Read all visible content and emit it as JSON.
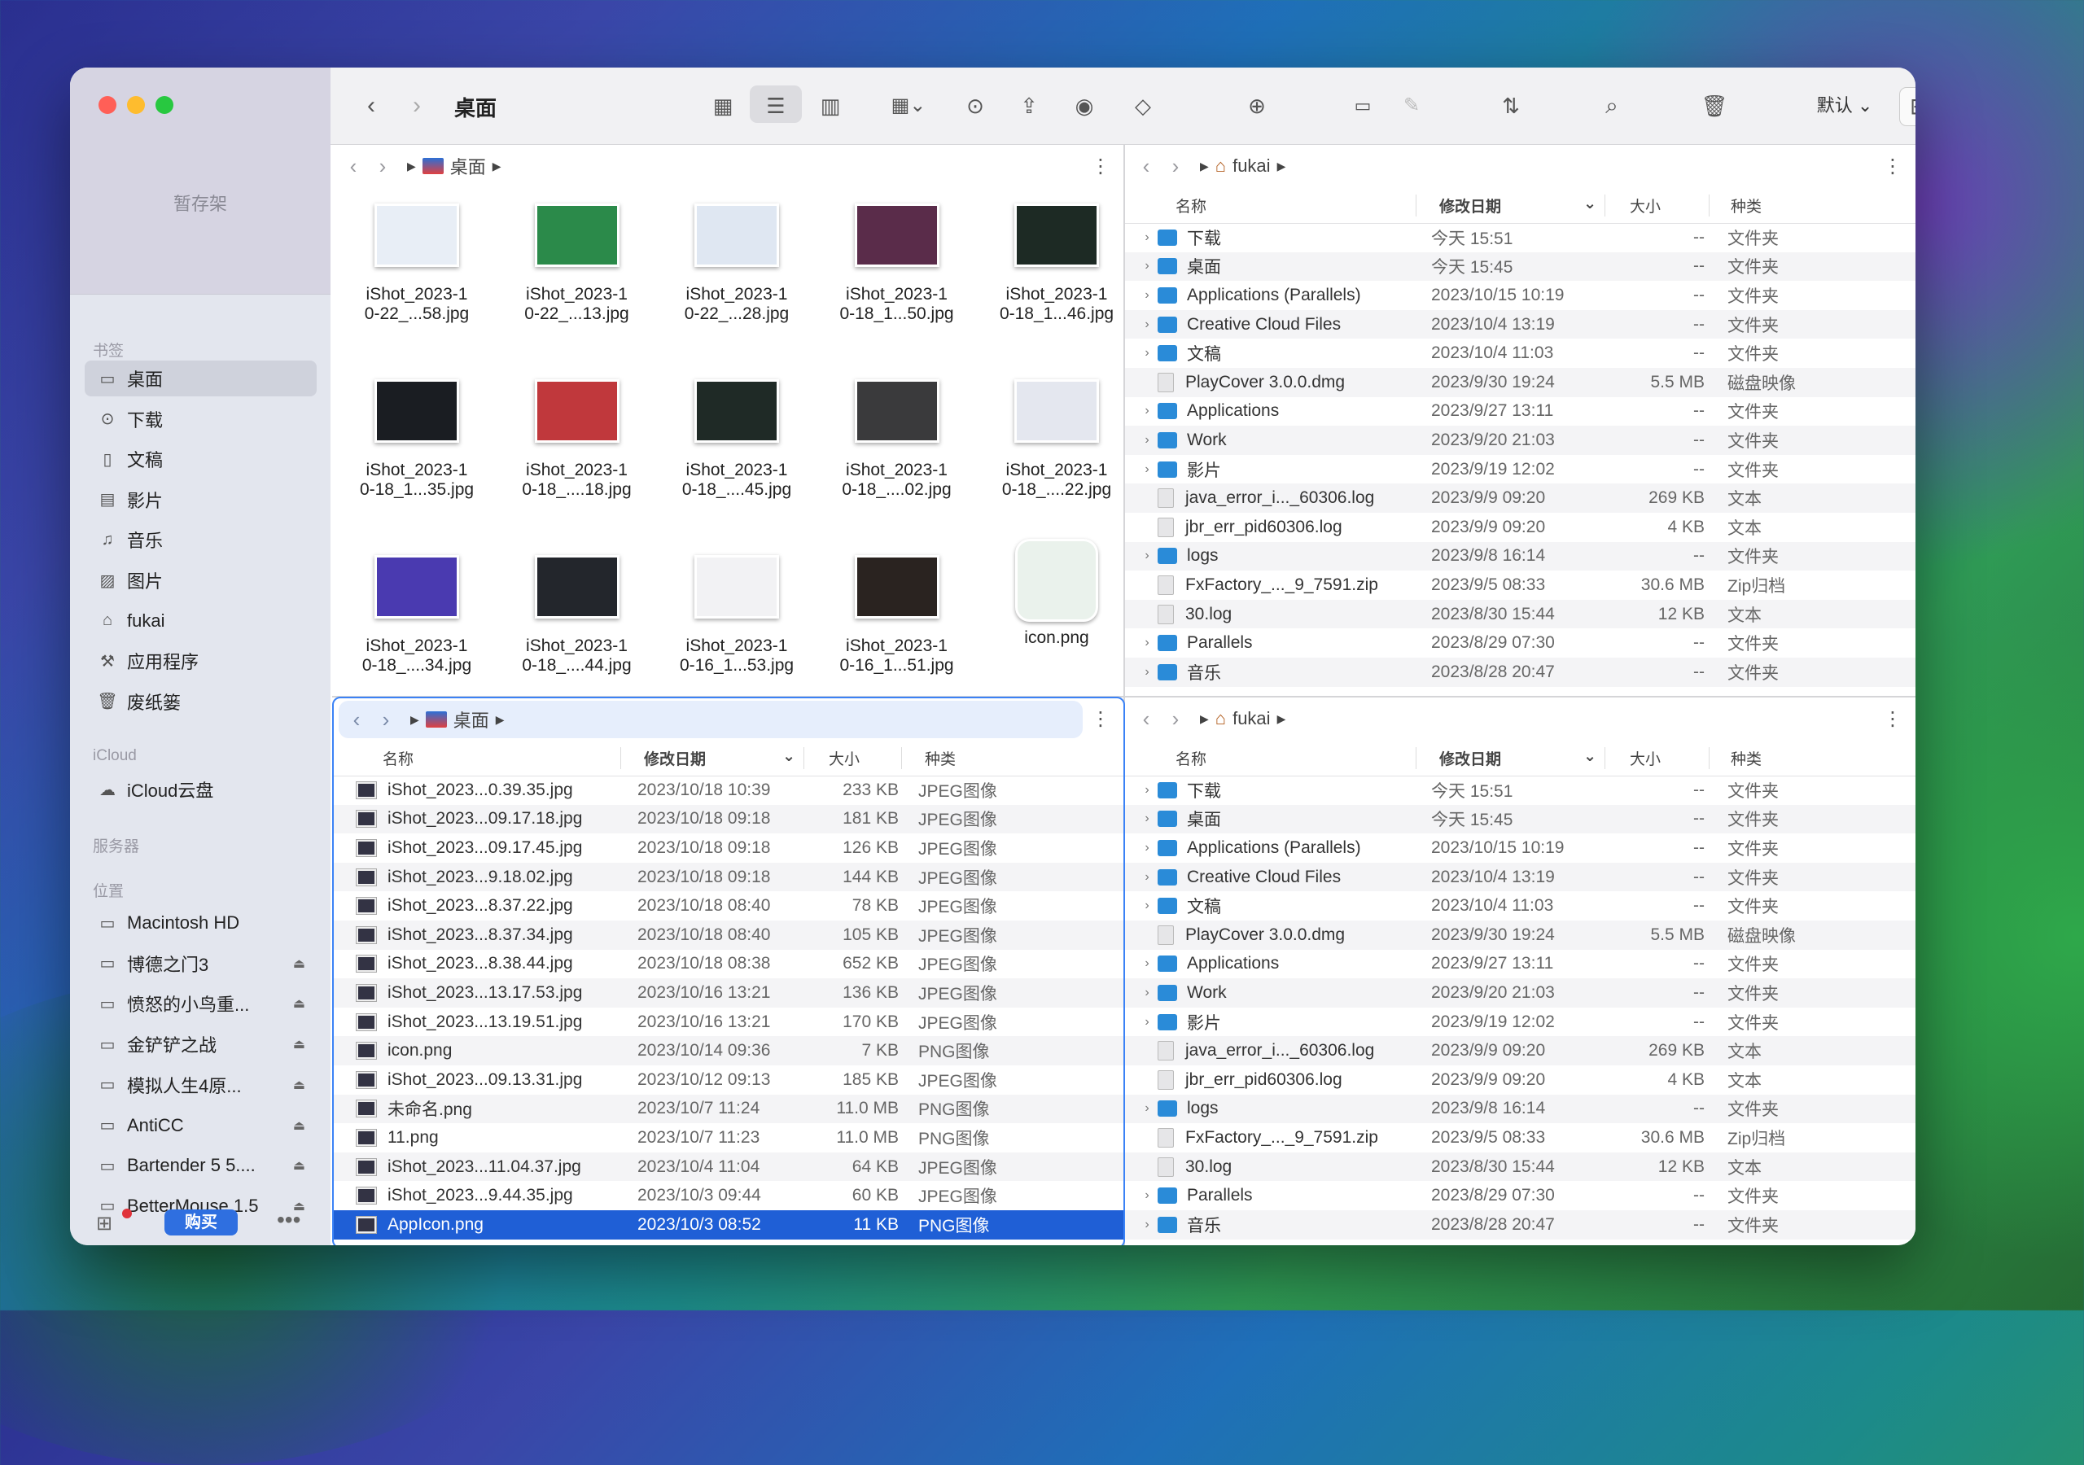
{
  "toolbar": {
    "title": "桌面",
    "default_label": "默认"
  },
  "sidebar": {
    "shelf_label": "暂存架",
    "sections": {
      "bookmarks": "书签",
      "icloud": "iCloud",
      "servers": "服务器",
      "locations": "位置"
    },
    "bookmarks": [
      {
        "label": "桌面",
        "icon": "desktop-icon"
      },
      {
        "label": "下载",
        "icon": "download-icon"
      },
      {
        "label": "文稿",
        "icon": "document-icon"
      },
      {
        "label": "影片",
        "icon": "film-icon"
      },
      {
        "label": "音乐",
        "icon": "music-icon"
      },
      {
        "label": "图片",
        "icon": "photo-icon"
      },
      {
        "label": "fukai",
        "icon": "home-icon"
      },
      {
        "label": "应用程序",
        "icon": "apps-icon"
      },
      {
        "label": "废纸篓",
        "icon": "trash-icon"
      }
    ],
    "icloud": [
      {
        "label": "iCloud云盘",
        "icon": "cloud-icon"
      }
    ],
    "locations": [
      {
        "label": "Macintosh HD"
      },
      {
        "label": "博德之门3"
      },
      {
        "label": "愤怒的小鸟重..."
      },
      {
        "label": "金铲铲之战"
      },
      {
        "label": "模拟人生4原..."
      },
      {
        "label": "AntiCC"
      },
      {
        "label": "Bartender 5 5...."
      },
      {
        "label": "BetterMouse 1.5"
      }
    ],
    "buy_label": "购买"
  },
  "pane_tl": {
    "path": "桌面",
    "items": [
      {
        "l1": "iShot_2023-1",
        "l2": "0-22_...58.jpg",
        "c": "#e8eef6"
      },
      {
        "l1": "iShot_2023-1",
        "l2": "0-22_...13.jpg",
        "c": "#2b8a4a"
      },
      {
        "l1": "iShot_2023-1",
        "l2": "0-22_...28.jpg",
        "c": "#dfe7f2"
      },
      {
        "l1": "iShot_2023-1",
        "l2": "0-18_1...50.jpg",
        "c": "#5a2c4a"
      },
      {
        "l1": "iShot_2023-1",
        "l2": "0-18_1...46.jpg",
        "c": "#1d2a24"
      },
      {
        "l1": "iShot_2023-1",
        "l2": "0-18_1...35.jpg",
        "c": "#1a1d22"
      },
      {
        "l1": "iShot_2023-1",
        "l2": "0-18_....18.jpg",
        "c": "#c0383c"
      },
      {
        "l1": "iShot_2023-1",
        "l2": "0-18_....45.jpg",
        "c": "#1f2a26"
      },
      {
        "l1": "iShot_2023-1",
        "l2": "0-18_....02.jpg",
        "c": "#3a3a3c"
      },
      {
        "l1": "iShot_2023-1",
        "l2": "0-18_....22.jpg",
        "c": "#e4e7ef"
      },
      {
        "l1": "iShot_2023-1",
        "l2": "0-18_....34.jpg",
        "c": "#4a3ab0"
      },
      {
        "l1": "iShot_2023-1",
        "l2": "0-18_....44.jpg",
        "c": "#23262c"
      },
      {
        "l1": "iShot_2023-1",
        "l2": "0-16_1...53.jpg",
        "c": "#f2f2f4"
      },
      {
        "l1": "iShot_2023-1",
        "l2": "0-16_1...51.jpg",
        "c": "#2a2320"
      },
      {
        "l1": "icon.png",
        "l2": "",
        "c": "#eaf2ec"
      }
    ]
  },
  "pane_bl": {
    "path": "桌面",
    "cols": {
      "name": "名称",
      "date": "修改日期",
      "size": "大小",
      "kind": "种类"
    },
    "rows": [
      {
        "name": "iShot_2023...0.39.35.jpg",
        "date": "2023/10/18 10:39",
        "size": "233 KB",
        "kind": "JPEG图像"
      },
      {
        "name": "iShot_2023...09.17.18.jpg",
        "date": "2023/10/18 09:18",
        "size": "181 KB",
        "kind": "JPEG图像"
      },
      {
        "name": "iShot_2023...09.17.45.jpg",
        "date": "2023/10/18 09:18",
        "size": "126 KB",
        "kind": "JPEG图像"
      },
      {
        "name": "iShot_2023...9.18.02.jpg",
        "date": "2023/10/18 09:18",
        "size": "144 KB",
        "kind": "JPEG图像"
      },
      {
        "name": "iShot_2023...8.37.22.jpg",
        "date": "2023/10/18 08:40",
        "size": "78 KB",
        "kind": "JPEG图像"
      },
      {
        "name": "iShot_2023...8.37.34.jpg",
        "date": "2023/10/18 08:40",
        "size": "105 KB",
        "kind": "JPEG图像"
      },
      {
        "name": "iShot_2023...8.38.44.jpg",
        "date": "2023/10/18 08:38",
        "size": "652 KB",
        "kind": "JPEG图像"
      },
      {
        "name": "iShot_2023...13.17.53.jpg",
        "date": "2023/10/16 13:21",
        "size": "136 KB",
        "kind": "JPEG图像"
      },
      {
        "name": "iShot_2023...13.19.51.jpg",
        "date": "2023/10/16 13:21",
        "size": "170 KB",
        "kind": "JPEG图像"
      },
      {
        "name": "icon.png",
        "date": "2023/10/14 09:36",
        "size": "7 KB",
        "kind": "PNG图像"
      },
      {
        "name": "iShot_2023...09.13.31.jpg",
        "date": "2023/10/12 09:13",
        "size": "185 KB",
        "kind": "JPEG图像"
      },
      {
        "name": "未命名.png",
        "date": "2023/10/7 11:24",
        "size": "11.0 MB",
        "kind": "PNG图像"
      },
      {
        "name": "11.png",
        "date": "2023/10/7 11:23",
        "size": "11.0 MB",
        "kind": "PNG图像"
      },
      {
        "name": "iShot_2023...11.04.37.jpg",
        "date": "2023/10/4 11:04",
        "size": "64 KB",
        "kind": "JPEG图像"
      },
      {
        "name": "iShot_2023...9.44.35.jpg",
        "date": "2023/10/3 09:44",
        "size": "60 KB",
        "kind": "JPEG图像"
      },
      {
        "name": "AppIcon.png",
        "date": "2023/10/3 08:52",
        "size": "11 KB",
        "kind": "PNG图像",
        "selected": true
      }
    ]
  },
  "pane_right": {
    "path": "fukai",
    "cols": {
      "name": "名称",
      "date": "修改日期",
      "size": "大小",
      "kind": "种类"
    },
    "rows": [
      {
        "name": "下载",
        "date": "今天 15:51",
        "size": "--",
        "kind": "文件夹",
        "folder": true
      },
      {
        "name": "桌面",
        "date": "今天 15:45",
        "size": "--",
        "kind": "文件夹",
        "folder": true
      },
      {
        "name": "Applications (Parallels)",
        "date": "2023/10/15 10:19",
        "size": "--",
        "kind": "文件夹",
        "folder": true
      },
      {
        "name": "Creative Cloud Files",
        "date": "2023/10/4 13:19",
        "size": "--",
        "kind": "文件夹",
        "folder": true
      },
      {
        "name": "文稿",
        "date": "2023/10/4 11:03",
        "size": "--",
        "kind": "文件夹",
        "folder": true
      },
      {
        "name": "PlayCover 3.0.0.dmg",
        "date": "2023/9/30 19:24",
        "size": "5.5 MB",
        "kind": "磁盘映像",
        "folder": false
      },
      {
        "name": "Applications",
        "date": "2023/9/27 13:11",
        "size": "--",
        "kind": "文件夹",
        "folder": true
      },
      {
        "name": "Work",
        "date": "2023/9/20 21:03",
        "size": "--",
        "kind": "文件夹",
        "folder": true
      },
      {
        "name": "影片",
        "date": "2023/9/19 12:02",
        "size": "--",
        "kind": "文件夹",
        "folder": true
      },
      {
        "name": "java_error_i..._60306.log",
        "date": "2023/9/9 09:20",
        "size": "269 KB",
        "kind": "文本",
        "folder": false
      },
      {
        "name": "jbr_err_pid60306.log",
        "date": "2023/9/9 09:20",
        "size": "4 KB",
        "kind": "文本",
        "folder": false
      },
      {
        "name": "logs",
        "date": "2023/9/8 16:14",
        "size": "--",
        "kind": "文件夹",
        "folder": true
      },
      {
        "name": "FxFactory_..._9_7591.zip",
        "date": "2023/9/5 08:33",
        "size": "30.6 MB",
        "kind": "Zip归档",
        "folder": false
      },
      {
        "name": "30.log",
        "date": "2023/8/30 15:44",
        "size": "12 KB",
        "kind": "文本",
        "folder": false
      },
      {
        "name": "Parallels",
        "date": "2023/8/29 07:30",
        "size": "--",
        "kind": "文件夹",
        "folder": true
      },
      {
        "name": "音乐",
        "date": "2023/8/28 20:47",
        "size": "--",
        "kind": "文件夹",
        "folder": true
      }
    ]
  }
}
